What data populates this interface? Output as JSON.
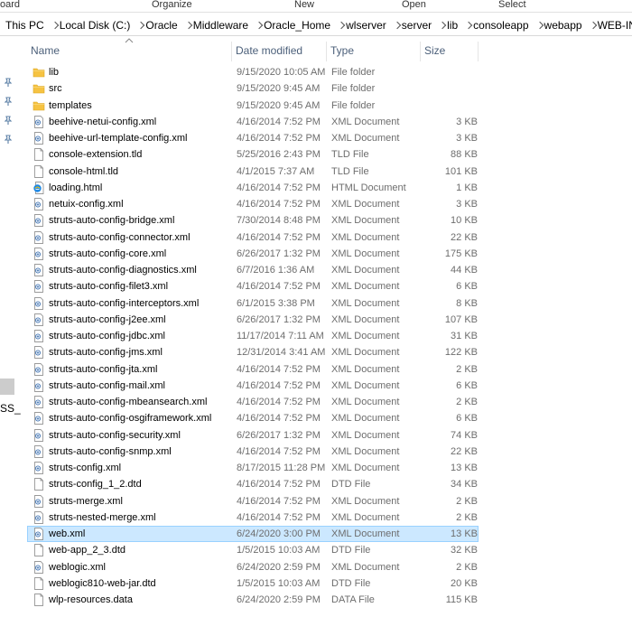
{
  "ribbon": {
    "group1": "oard",
    "group2": "Organize",
    "group3": "New",
    "group4": "Open",
    "group5": "Select"
  },
  "breadcrumb": [
    "This PC",
    "Local Disk (C:)",
    "Oracle",
    "Middleware",
    "Oracle_Home",
    "wlserver",
    "server",
    "lib",
    "consoleapp",
    "webapp",
    "WEB-INF"
  ],
  "nav_pane": {
    "truncated_label": "SS_"
  },
  "columns": {
    "name": "Name",
    "date": "Date modified",
    "type": "Type",
    "size": "Size"
  },
  "files": [
    {
      "name": "lib",
      "date": "9/15/2020 10:05 AM",
      "type": "File folder",
      "size": "",
      "icon": "folder-icon"
    },
    {
      "name": "src",
      "date": "9/15/2020 9:45 AM",
      "type": "File folder",
      "size": "",
      "icon": "folder-icon"
    },
    {
      "name": "templates",
      "date": "9/15/2020 9:45 AM",
      "type": "File folder",
      "size": "",
      "icon": "folder-icon"
    },
    {
      "name": "beehive-netui-config.xml",
      "date": "4/16/2014 7:52 PM",
      "type": "XML Document",
      "size": "3 KB",
      "icon": "xml-file-icon"
    },
    {
      "name": "beehive-url-template-config.xml",
      "date": "4/16/2014 7:52 PM",
      "type": "XML Document",
      "size": "3 KB",
      "icon": "xml-file-icon"
    },
    {
      "name": "console-extension.tld",
      "date": "5/25/2016 2:43 PM",
      "type": "TLD File",
      "size": "88 KB",
      "icon": "file-icon"
    },
    {
      "name": "console-html.tld",
      "date": "4/1/2015 7:37 AM",
      "type": "TLD File",
      "size": "101 KB",
      "icon": "file-icon"
    },
    {
      "name": "loading.html",
      "date": "4/16/2014 7:52 PM",
      "type": "HTML Document",
      "size": "1 KB",
      "icon": "html-file-icon"
    },
    {
      "name": "netuix-config.xml",
      "date": "4/16/2014 7:52 PM",
      "type": "XML Document",
      "size": "3 KB",
      "icon": "xml-file-icon"
    },
    {
      "name": "struts-auto-config-bridge.xml",
      "date": "7/30/2014 8:48 PM",
      "type": "XML Document",
      "size": "10 KB",
      "icon": "xml-file-icon"
    },
    {
      "name": "struts-auto-config-connector.xml",
      "date": "4/16/2014 7:52 PM",
      "type": "XML Document",
      "size": "22 KB",
      "icon": "xml-file-icon"
    },
    {
      "name": "struts-auto-config-core.xml",
      "date": "6/26/2017 1:32 PM",
      "type": "XML Document",
      "size": "175 KB",
      "icon": "xml-file-icon"
    },
    {
      "name": "struts-auto-config-diagnostics.xml",
      "date": "6/7/2016 1:36 AM",
      "type": "XML Document",
      "size": "44 KB",
      "icon": "xml-file-icon"
    },
    {
      "name": "struts-auto-config-filet3.xml",
      "date": "4/16/2014 7:52 PM",
      "type": "XML Document",
      "size": "6 KB",
      "icon": "xml-file-icon"
    },
    {
      "name": "struts-auto-config-interceptors.xml",
      "date": "6/1/2015 3:38 PM",
      "type": "XML Document",
      "size": "8 KB",
      "icon": "xml-file-icon"
    },
    {
      "name": "struts-auto-config-j2ee.xml",
      "date": "6/26/2017 1:32 PM",
      "type": "XML Document",
      "size": "107 KB",
      "icon": "xml-file-icon"
    },
    {
      "name": "struts-auto-config-jdbc.xml",
      "date": "11/17/2014 7:11 AM",
      "type": "XML Document",
      "size": "31 KB",
      "icon": "xml-file-icon"
    },
    {
      "name": "struts-auto-config-jms.xml",
      "date": "12/31/2014 3:41 AM",
      "type": "XML Document",
      "size": "122 KB",
      "icon": "xml-file-icon"
    },
    {
      "name": "struts-auto-config-jta.xml",
      "date": "4/16/2014 7:52 PM",
      "type": "XML Document",
      "size": "2 KB",
      "icon": "xml-file-icon"
    },
    {
      "name": "struts-auto-config-mail.xml",
      "date": "4/16/2014 7:52 PM",
      "type": "XML Document",
      "size": "6 KB",
      "icon": "xml-file-icon"
    },
    {
      "name": "struts-auto-config-mbeansearch.xml",
      "date": "4/16/2014 7:52 PM",
      "type": "XML Document",
      "size": "2 KB",
      "icon": "xml-file-icon"
    },
    {
      "name": "struts-auto-config-osgiframework.xml",
      "date": "4/16/2014 7:52 PM",
      "type": "XML Document",
      "size": "6 KB",
      "icon": "xml-file-icon"
    },
    {
      "name": "struts-auto-config-security.xml",
      "date": "6/26/2017 1:32 PM",
      "type": "XML Document",
      "size": "74 KB",
      "icon": "xml-file-icon"
    },
    {
      "name": "struts-auto-config-snmp.xml",
      "date": "4/16/2014 7:52 PM",
      "type": "XML Document",
      "size": "22 KB",
      "icon": "xml-file-icon"
    },
    {
      "name": "struts-config.xml",
      "date": "8/17/2015 11:28 PM",
      "type": "XML Document",
      "size": "13 KB",
      "icon": "xml-file-icon"
    },
    {
      "name": "struts-config_1_2.dtd",
      "date": "4/16/2014 7:52 PM",
      "type": "DTD File",
      "size": "34 KB",
      "icon": "file-icon"
    },
    {
      "name": "struts-merge.xml",
      "date": "4/16/2014 7:52 PM",
      "type": "XML Document",
      "size": "2 KB",
      "icon": "xml-file-icon"
    },
    {
      "name": "struts-nested-merge.xml",
      "date": "4/16/2014 7:52 PM",
      "type": "XML Document",
      "size": "2 KB",
      "icon": "xml-file-icon"
    },
    {
      "name": "web.xml",
      "date": "6/24/2020 3:00 PM",
      "type": "XML Document",
      "size": "13 KB",
      "icon": "xml-file-icon",
      "selected": true
    },
    {
      "name": "web-app_2_3.dtd",
      "date": "1/5/2015 10:03 AM",
      "type": "DTD File",
      "size": "32 KB",
      "icon": "file-icon"
    },
    {
      "name": "weblogic.xml",
      "date": "6/24/2020 2:59 PM",
      "type": "XML Document",
      "size": "2 KB",
      "icon": "xml-file-icon"
    },
    {
      "name": "weblogic810-web-jar.dtd",
      "date": "1/5/2015 10:03 AM",
      "type": "DTD File",
      "size": "20 KB",
      "icon": "file-icon"
    },
    {
      "name": "wlp-resources.data",
      "date": "6/24/2020 2:59 PM",
      "type": "DATA File",
      "size": "115 KB",
      "icon": "file-icon"
    }
  ],
  "colors": {
    "selection_bg": "#cce8ff",
    "selection_border": "#99d1ff",
    "header_text": "#4c607a",
    "folder": "#f6c342"
  }
}
